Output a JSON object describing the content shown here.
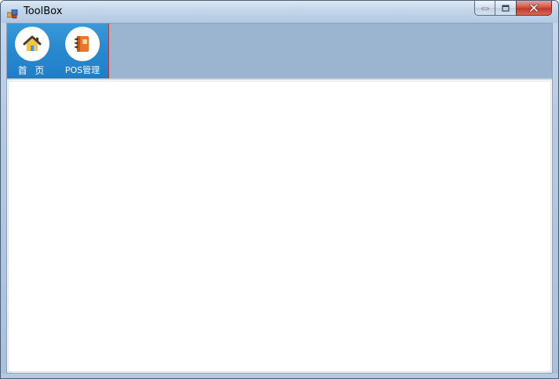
{
  "window": {
    "title": "ToolBox"
  },
  "toolbar": {
    "items": [
      {
        "label": "首 页",
        "icon": "home-icon"
      },
      {
        "label": "POS管理",
        "icon": "notebook-icon"
      }
    ]
  },
  "colors": {
    "toolbar_group": "#2a8bd1",
    "toolbar_bg": "#9bb5d1",
    "close_button": "#c23a2a"
  }
}
